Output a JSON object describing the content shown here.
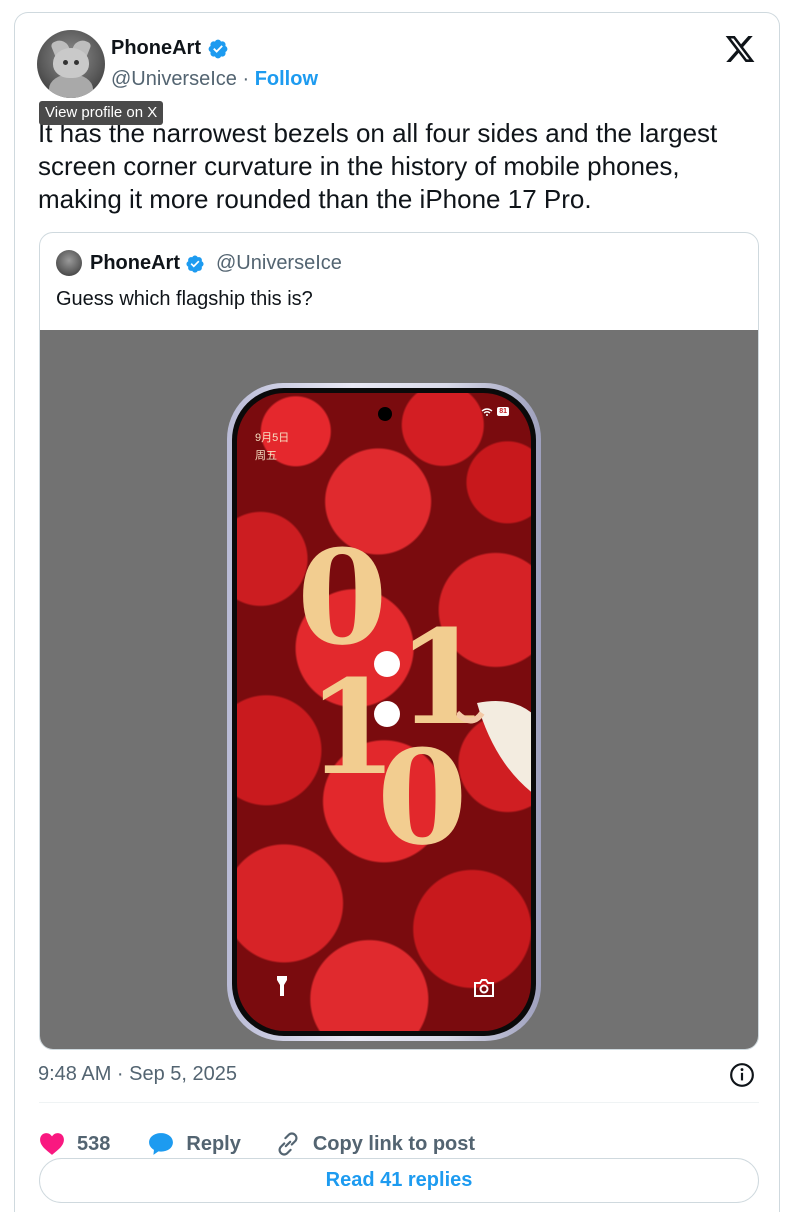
{
  "author": {
    "name": "PhoneArt",
    "handle": "@UniverseIce",
    "separator": " · ",
    "follow_label": "Follow",
    "tooltip": "View profile on X"
  },
  "tweet": {
    "text": "It has the narrowest bezels on all four sides and the largest screen corner curvature in the history of mobile phones, making it more rounded than the iPhone 17 Pro.",
    "timestamp": "9:48 AM · Sep 5, 2025"
  },
  "quoted_tweet": {
    "name": "PhoneArt",
    "handle": "@UniverseIce",
    "text": "Guess which flagship this is?",
    "phone_screen": {
      "date_line1": "9月5日",
      "date_line2": "周五",
      "clock_digits": [
        "0",
        "1",
        "1",
        "0"
      ],
      "battery": "81"
    }
  },
  "actions": {
    "like_count": "538",
    "reply_label": "Reply",
    "copy_label": "Copy link to post"
  },
  "read_replies_label": "Read 41 replies",
  "colors": {
    "accent": "#1d9bf0",
    "like": "#f91880",
    "secondary_text": "#536471",
    "clock": "#f2cd90"
  },
  "icons": [
    "verified-badge-icon",
    "x-logo-icon",
    "info-icon",
    "heart-icon",
    "reply-bubble-icon",
    "link-icon",
    "flashlight-icon",
    "camera-icon"
  ]
}
